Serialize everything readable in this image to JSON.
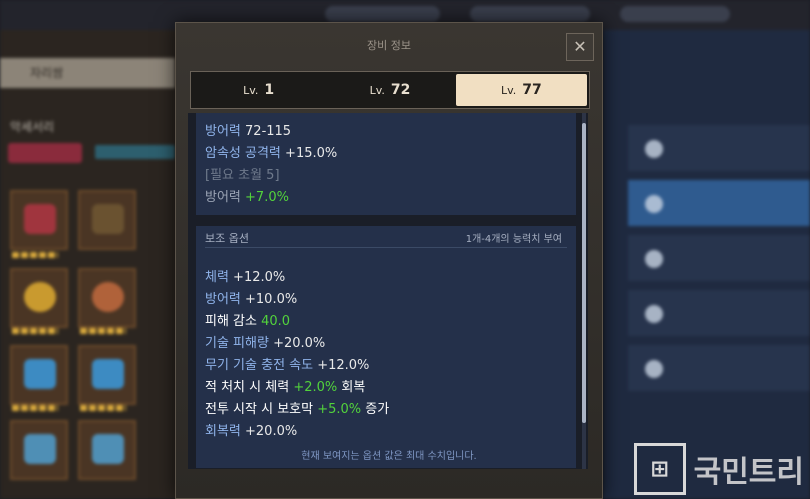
{
  "modal": {
    "title": "장비 정보",
    "close_glyph": "✕",
    "tabs": [
      {
        "lv": "Lv.",
        "num": "1",
        "active": false
      },
      {
        "lv": "Lv.",
        "num": "72",
        "active": false
      },
      {
        "lv": "Lv.",
        "num": "77",
        "active": true
      }
    ],
    "main_options": {
      "lines": [
        {
          "label": "방어력",
          "value": "72-115"
        },
        {
          "label": "암속성 공격력",
          "value": "+15.0%"
        }
      ],
      "requirement": "[필요 초월 5]",
      "transcend": {
        "label": "방어력",
        "value": "+7.0%"
      }
    },
    "sub_options": {
      "title": "보조 옵션",
      "note": "1개-4개의 능력치 부여",
      "lines": [
        {
          "pre": "체력",
          "mid": " +12.0%",
          "green": "",
          "post": ""
        },
        {
          "pre": "방어력",
          "mid": " +10.0%",
          "green": "",
          "post": ""
        },
        {
          "pre": "피해 감소",
          "mid": " ",
          "green": "40.0",
          "post": ""
        },
        {
          "pre": "기술 피해량",
          "mid": " +20.0%",
          "green": "",
          "post": ""
        },
        {
          "pre": "무기 기술 충전 속도",
          "mid": " +12.0%",
          "green": "",
          "post": ""
        },
        {
          "pre": "적 처치 시 체력",
          "mid": " ",
          "green": "+2.0%",
          "post": " 회복"
        },
        {
          "pre": "전투 시작 시 보호막",
          "mid": " ",
          "green": "+5.0%",
          "post": " 증가"
        },
        {
          "pre": "회복력",
          "mid": " +20.0%",
          "green": "",
          "post": ""
        }
      ]
    },
    "footer": "현재 보여지는 옵션 값은 최대 수치입니다."
  },
  "background": {
    "left_tab": "자리쌈",
    "left_title": "악세서리"
  },
  "watermark": {
    "text": "국민트리"
  }
}
